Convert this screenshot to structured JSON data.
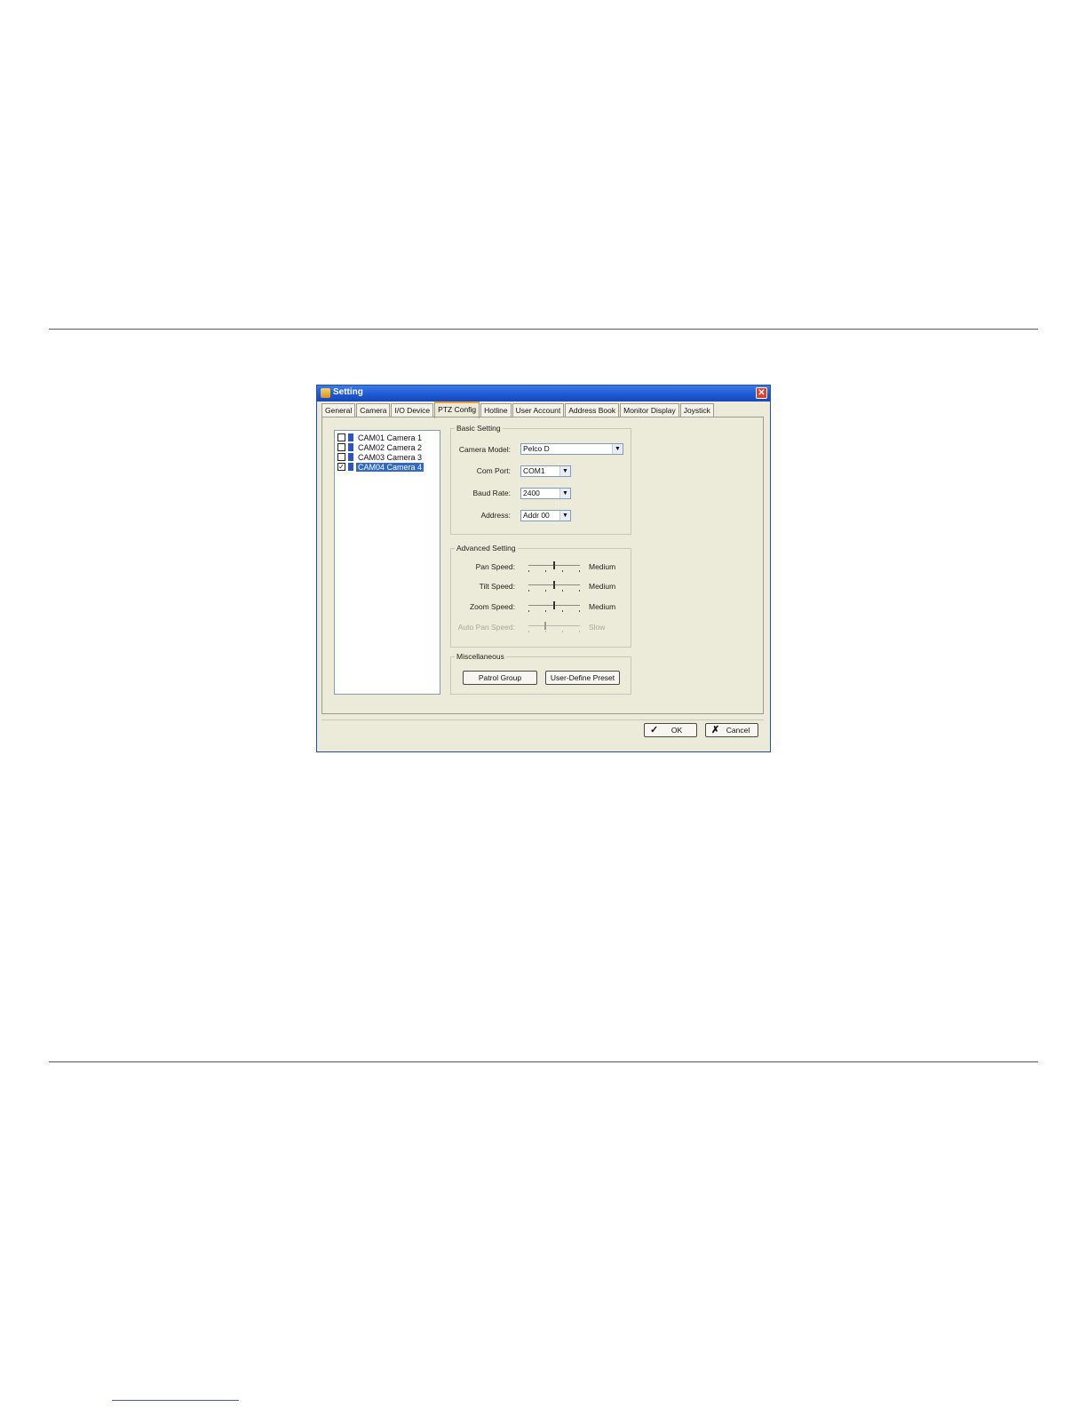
{
  "window": {
    "title": "Setting",
    "close_glyph": "✕"
  },
  "tabs": [
    {
      "label": "General"
    },
    {
      "label": "Camera"
    },
    {
      "label": "I/O Device"
    },
    {
      "label": "PTZ Config",
      "active": true
    },
    {
      "label": "Hotline"
    },
    {
      "label": "User Account"
    },
    {
      "label": "Address Book"
    },
    {
      "label": "Monitor Display"
    },
    {
      "label": "Joystick"
    }
  ],
  "cameras": [
    {
      "label": "CAM01 Camera 1",
      "checked": false,
      "selected": false
    },
    {
      "label": "CAM02 Camera 2",
      "checked": false,
      "selected": false
    },
    {
      "label": "CAM03 Camera 3",
      "checked": false,
      "selected": false
    },
    {
      "label": "CAM04 Camera 4",
      "checked": true,
      "selected": true
    }
  ],
  "basic_setting": {
    "title": "Basic Setting",
    "camera_model": {
      "label": "Camera Model:",
      "value": "Pelco D"
    },
    "com_port": {
      "label": "Com Port:",
      "value": "COM1"
    },
    "baud_rate": {
      "label": "Baud Rate:",
      "value": "2400"
    },
    "address": {
      "label": "Address:",
      "value": "Addr 00"
    }
  },
  "advanced_setting": {
    "title": "Advanced Setting",
    "pan_speed": {
      "label": "Pan Speed:",
      "value": "Medium",
      "level": 0.5
    },
    "tilt_speed": {
      "label": "Tilt Speed:",
      "value": "Medium",
      "level": 0.5
    },
    "zoom_speed": {
      "label": "Zoom Speed:",
      "value": "Medium",
      "level": 0.5
    },
    "auto_pan_speed": {
      "label": "Auto Pan Speed:",
      "value": "Slow",
      "level": 0.33,
      "disabled": true
    }
  },
  "miscellaneous": {
    "title": "Miscellaneous",
    "patrol_group": "Patrol Group",
    "user_define_preset": "User-Define Preset"
  },
  "footer": {
    "ok": "OK",
    "cancel": "Cancel"
  },
  "icons": {
    "ok": "check-icon",
    "cancel": "x-icon",
    "app": "hand-icon",
    "camera": "camera-icon"
  },
  "colors": {
    "titlebar": "#1d56d2",
    "selection": "#316ac5",
    "dialog_bg": "#ecead8"
  }
}
